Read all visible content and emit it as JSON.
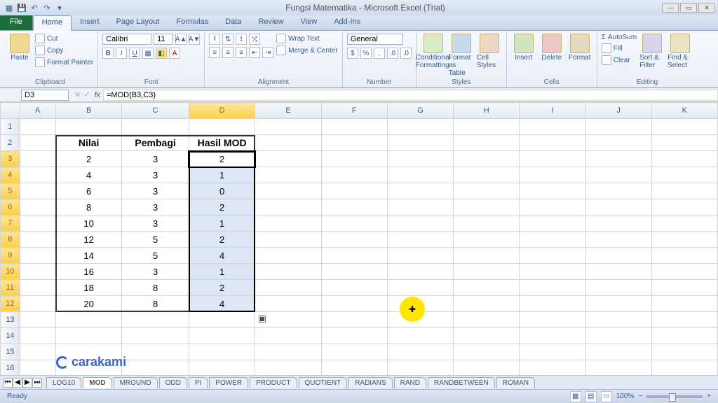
{
  "titlebar": {
    "title": "Fungsi Matematika - Microsoft Excel (Trial)"
  },
  "ribbon_tabs": {
    "file": "File",
    "items": [
      "Home",
      "Insert",
      "Page Layout",
      "Formulas",
      "Data",
      "Review",
      "View",
      "Add-Ins"
    ],
    "active": "Home"
  },
  "ribbon": {
    "clipboard": {
      "paste": "Paste",
      "cut": "Cut",
      "copy": "Copy",
      "painter": "Format Painter",
      "label": "Clipboard"
    },
    "font": {
      "name": "Calibri",
      "size": "11",
      "label": "Font",
      "bold": "B",
      "italic": "I",
      "underline": "U"
    },
    "alignment": {
      "wrap": "Wrap Text",
      "merge": "Merge & Center",
      "label": "Alignment"
    },
    "number": {
      "format": "General",
      "label": "Number"
    },
    "styles": {
      "cond": "Conditional Formatting",
      "table": "Format as Table",
      "cell": "Cell Styles",
      "label": "Styles"
    },
    "cells": {
      "insert": "Insert",
      "delete": "Delete",
      "format": "Format",
      "label": "Cells"
    },
    "editing": {
      "sum": "AutoSum",
      "fill": "Fill",
      "clear": "Clear",
      "sort": "Sort & Filter",
      "find": "Find & Select",
      "label": "Editing"
    }
  },
  "namebox": "D3",
  "formula": "=MOD(B3,C3)",
  "columns": [
    "A",
    "B",
    "C",
    "D",
    "E",
    "F",
    "G",
    "H",
    "I",
    "J",
    "K"
  ],
  "rows": 17,
  "headers": {
    "b": "Nilai",
    "c": "Pembagi",
    "d": "Hasil MOD"
  },
  "chart_data": {
    "type": "table",
    "columns": [
      "Nilai",
      "Pembagi",
      "Hasil MOD"
    ],
    "rows": [
      [
        2,
        3,
        2
      ],
      [
        4,
        3,
        1
      ],
      [
        6,
        3,
        0
      ],
      [
        8,
        3,
        2
      ],
      [
        10,
        3,
        1
      ],
      [
        12,
        5,
        2
      ],
      [
        14,
        5,
        4
      ],
      [
        16,
        3,
        1
      ],
      [
        18,
        8,
        2
      ],
      [
        20,
        8,
        4
      ]
    ]
  },
  "sheet_tabs": {
    "items": [
      "LOG10",
      "MOD",
      "MROUND",
      "ODD",
      "PI",
      "POWER",
      "PRODUCT",
      "QUOTIENT",
      "RADIANS",
      "RAND",
      "RANDBETWEEN",
      "ROMAN"
    ],
    "active": "MOD"
  },
  "status": {
    "ready": "Ready",
    "zoom": "100%"
  },
  "watermark": "carakami"
}
